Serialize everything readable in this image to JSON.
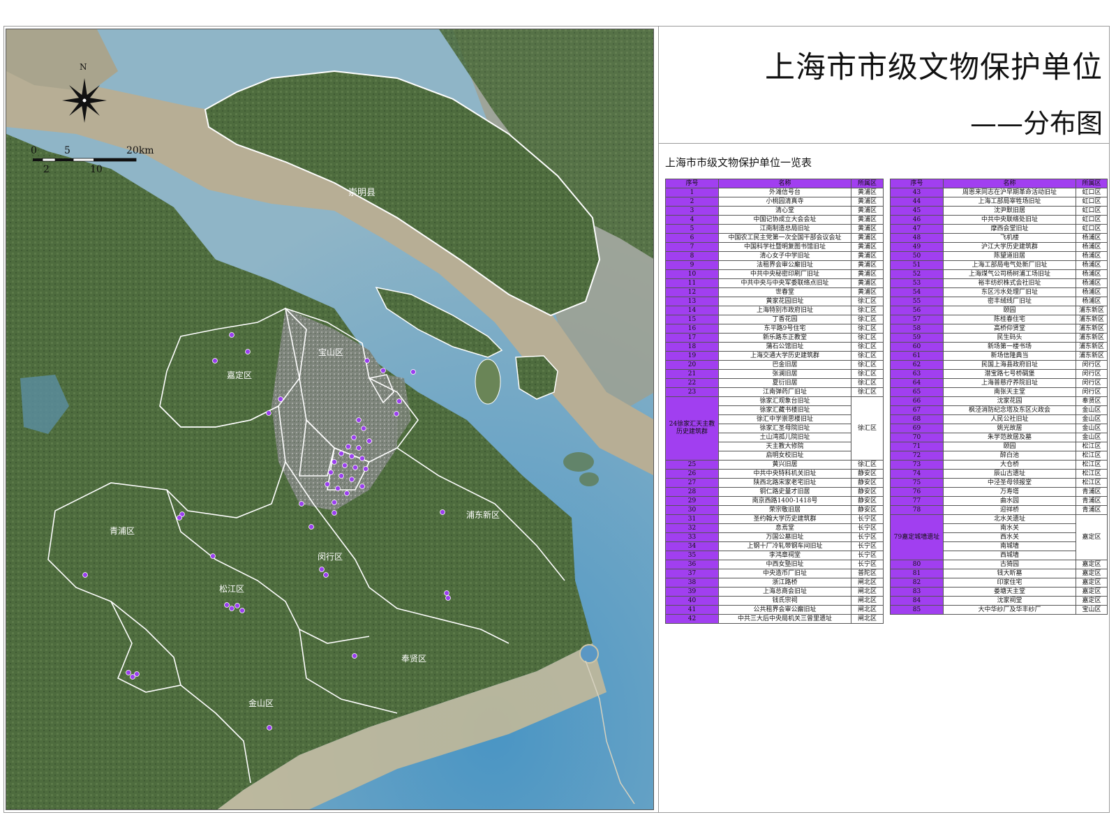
{
  "title": {
    "main": "上海市市级文物保护单位",
    "sub": "——分布图"
  },
  "map": {
    "north_label": "N",
    "scale_labels": {
      "top": [
        "0",
        "5",
        "20km"
      ],
      "bottom": [
        "2",
        "10"
      ]
    },
    "district_labels": [
      {
        "id": "chongming",
        "name": "崇明县"
      },
      {
        "id": "baoshan",
        "name": "宝山区"
      },
      {
        "id": "jiading",
        "name": "嘉定区"
      },
      {
        "id": "qingpu",
        "name": "青浦区"
      },
      {
        "id": "pudong",
        "name": "浦东新区"
      },
      {
        "id": "minhang",
        "name": "闵行区"
      },
      {
        "id": "songjiang",
        "name": "松江区"
      },
      {
        "id": "fengxian",
        "name": "奉贤区"
      },
      {
        "id": "jinshan",
        "name": "金山区"
      }
    ],
    "colors": {
      "water_sea": "#6fa9c8",
      "river": "#b9b29b",
      "land": "#4f6d3f",
      "urban": "#8a8f86",
      "marker": "#9b3ff0",
      "boundary": "#ffffff"
    }
  },
  "table": {
    "caption": "上海市市级文物保护单位一览表",
    "headers": [
      "序号",
      "名称",
      "所属区"
    ],
    "left_rows": [
      {
        "no": "1",
        "name": "外滩信号台",
        "district": "黄浦区"
      },
      {
        "no": "2",
        "name": "小桃园清真寺",
        "district": "黄浦区"
      },
      {
        "no": "3",
        "name": "清心堂",
        "district": "黄浦区"
      },
      {
        "no": "4",
        "name": "中国记协成立大会会址",
        "district": "黄浦区"
      },
      {
        "no": "5",
        "name": "江南制造总局旧址",
        "district": "黄浦区"
      },
      {
        "no": "6",
        "name": "中国农工民主党第一次全国干部会议会址",
        "district": "黄浦区"
      },
      {
        "no": "7",
        "name": "中国科学社暨明复图书馆旧址",
        "district": "黄浦区"
      },
      {
        "no": "8",
        "name": "清心女子中学旧址",
        "district": "黄浦区"
      },
      {
        "no": "9",
        "name": "法租界会审公廨旧址",
        "district": "黄浦区"
      },
      {
        "no": "10",
        "name": "中共中央秘密印刷厂旧址",
        "district": "黄浦区"
      },
      {
        "no": "11",
        "name": "中共中央与中央军委联络点旧址",
        "district": "黄浦区"
      },
      {
        "no": "12",
        "name": "世春堂",
        "district": "黄浦区"
      },
      {
        "no": "13",
        "name": "黄家花园旧址",
        "district": "徐汇区"
      },
      {
        "no": "14",
        "name": "上海特别市政府旧址",
        "district": "徐汇区"
      },
      {
        "no": "15",
        "name": "丁香花园",
        "district": "徐汇区"
      },
      {
        "no": "16",
        "name": "东平路9号住宅",
        "district": "徐汇区"
      },
      {
        "no": "17",
        "name": "新乐路东正教堂",
        "district": "徐汇区"
      },
      {
        "no": "18",
        "name": "蒲石公馆旧址",
        "district": "徐汇区"
      },
      {
        "no": "19",
        "name": "上海交通大学历史建筑群",
        "district": "徐汇区"
      },
      {
        "no": "20",
        "name": "巴金旧居",
        "district": "徐汇区"
      },
      {
        "no": "21",
        "name": "张澜旧居",
        "district": "徐汇区"
      },
      {
        "no": "22",
        "name": "夏衍旧居",
        "district": "徐汇区"
      },
      {
        "no": "23",
        "name": "江南弹药厂旧址",
        "district": "徐汇区"
      }
    ],
    "group24": {
      "label": "24徐家汇天主教历史建筑群",
      "district": "徐汇区",
      "items": [
        "徐家汇观象台旧址",
        "徐家汇藏书楼旧址",
        "徐汇中学崇思楼旧址",
        "徐家汇圣母院旧址",
        "土山湾孤儿院旧址",
        "天主教大修院",
        "启明女校旧址"
      ]
    },
    "left_rows_after": [
      {
        "no": "25",
        "name": "黄兴旧居",
        "district": "徐汇区"
      },
      {
        "no": "26",
        "name": "中共中央特科机关旧址",
        "district": "静安区"
      },
      {
        "no": "27",
        "name": "陕西北路宋家老宅旧址",
        "district": "静安区"
      },
      {
        "no": "28",
        "name": "铜仁路史量才旧居",
        "district": "静安区"
      },
      {
        "no": "29",
        "name": "南京西路1400-1418号",
        "district": "静安区"
      },
      {
        "no": "30",
        "name": "荣宗敬旧居",
        "district": "静安区"
      },
      {
        "no": "31",
        "name": "圣约翰大学历史建筑群",
        "district": "长宁区"
      },
      {
        "no": "32",
        "name": "息焉堂",
        "district": "长宁区"
      },
      {
        "no": "33",
        "name": "万国公墓旧址",
        "district": "长宁区"
      },
      {
        "no": "34",
        "name": "上钢十厂冷轧带钢车间旧址",
        "district": "长宁区"
      },
      {
        "no": "35",
        "name": "李鸿章祠堂",
        "district": "长宁区"
      },
      {
        "no": "36",
        "name": "中西女塾旧址",
        "district": "长宁区"
      },
      {
        "no": "37",
        "name": "中央造币厂旧址",
        "district": "普陀区"
      },
      {
        "no": "38",
        "name": "浙江路桥",
        "district": "闸北区"
      },
      {
        "no": "39",
        "name": "上海总商会旧址",
        "district": "闸北区"
      },
      {
        "no": "40",
        "name": "钱氏宗祠",
        "district": "闸北区"
      },
      {
        "no": "41",
        "name": "公共租界会审公廨旧址",
        "district": "闸北区"
      },
      {
        "no": "42",
        "name": "中共三大后中央局机关三曾里遗址",
        "district": "闸北区"
      }
    ],
    "right_rows": [
      {
        "no": "43",
        "name": "周恩来同志在沪早期革命活动旧址",
        "district": "虹口区"
      },
      {
        "no": "44",
        "name": "上海工部局宰牲场旧址",
        "district": "虹口区"
      },
      {
        "no": "45",
        "name": "沈尹默旧居",
        "district": "虹口区"
      },
      {
        "no": "46",
        "name": "中共中央联络处旧址",
        "district": "虹口区"
      },
      {
        "no": "47",
        "name": "摩西会堂旧址",
        "district": "虹口区"
      },
      {
        "no": "48",
        "name": "飞机楼",
        "district": "杨浦区"
      },
      {
        "no": "49",
        "name": "沪江大学历史建筑群",
        "district": "杨浦区"
      },
      {
        "no": "50",
        "name": "陈望道旧居",
        "district": "杨浦区"
      },
      {
        "no": "51",
        "name": "上海工部局电气处新厂旧址",
        "district": "杨浦区"
      },
      {
        "no": "52",
        "name": "上海煤气公司杨树浦工场旧址",
        "district": "杨浦区"
      },
      {
        "no": "53",
        "name": "裕丰纺织株式会社旧址",
        "district": "杨浦区"
      },
      {
        "no": "54",
        "name": "东区污水处理厂旧址",
        "district": "杨浦区"
      },
      {
        "no": "55",
        "name": "密丰绒线厂旧址",
        "district": "杨浦区"
      },
      {
        "no": "56",
        "name": "颐园",
        "district": "浦东新区"
      },
      {
        "no": "57",
        "name": "陈桂春住宅",
        "district": "浦东新区"
      },
      {
        "no": "58",
        "name": "高桥仰贤堂",
        "district": "浦东新区"
      },
      {
        "no": "59",
        "name": "民生码头",
        "district": "浦东新区"
      },
      {
        "no": "60",
        "name": "新场第一楼书场",
        "district": "浦东新区"
      },
      {
        "no": "61",
        "name": "新场信隆典当",
        "district": "浦东新区"
      },
      {
        "no": "62",
        "name": "民国上海县政府旧址",
        "district": "闵行区"
      },
      {
        "no": "63",
        "name": "潜宝路七号桥碉堡",
        "district": "闵行区"
      },
      {
        "no": "64",
        "name": "上海普慈疗养院旧址",
        "district": "闵行区"
      },
      {
        "no": "65",
        "name": "南张天主堂",
        "district": "闵行区"
      },
      {
        "no": "66",
        "name": "沈家花园",
        "district": "奉贤区"
      },
      {
        "no": "67",
        "name": "枫泾消防纪念塔及东区火政会",
        "district": "金山区"
      },
      {
        "no": "68",
        "name": "人民公社旧址",
        "district": "金山区"
      },
      {
        "no": "69",
        "name": "姚光故居",
        "district": "金山区"
      },
      {
        "no": "70",
        "name": "朱学范故居及墓",
        "district": "金山区"
      },
      {
        "no": "71",
        "name": "颐园",
        "district": "松江区"
      },
      {
        "no": "72",
        "name": "醉白池",
        "district": "松江区"
      },
      {
        "no": "73",
        "name": "大仓桥",
        "district": "松江区"
      },
      {
        "no": "74",
        "name": "辰山古遗址",
        "district": "松江区"
      },
      {
        "no": "75",
        "name": "中泾圣母领报堂",
        "district": "松江区"
      },
      {
        "no": "76",
        "name": "万寿塔",
        "district": "青浦区"
      },
      {
        "no": "77",
        "name": "曲水园",
        "district": "青浦区"
      },
      {
        "no": "78",
        "name": "迎祥桥",
        "district": "青浦区"
      }
    ],
    "group79": {
      "label": "79嘉定城墙遗址",
      "district": "嘉定区",
      "items": [
        "北水关遗址",
        "南水关",
        "西水关",
        "南城墙",
        "西城墙"
      ]
    },
    "right_rows_after": [
      {
        "no": "80",
        "name": "古猗园",
        "district": "嘉定区"
      },
      {
        "no": "81",
        "name": "钱大昕墓",
        "district": "嘉定区"
      },
      {
        "no": "82",
        "name": "印家住宅",
        "district": "嘉定区"
      },
      {
        "no": "83",
        "name": "娄塘天主堂",
        "district": "嘉定区"
      },
      {
        "no": "84",
        "name": "沈家祠堂",
        "district": "嘉定区"
      },
      {
        "no": "85",
        "name": "大中华纱厂及华丰纱厂",
        "district": "宝山区"
      }
    ]
  }
}
